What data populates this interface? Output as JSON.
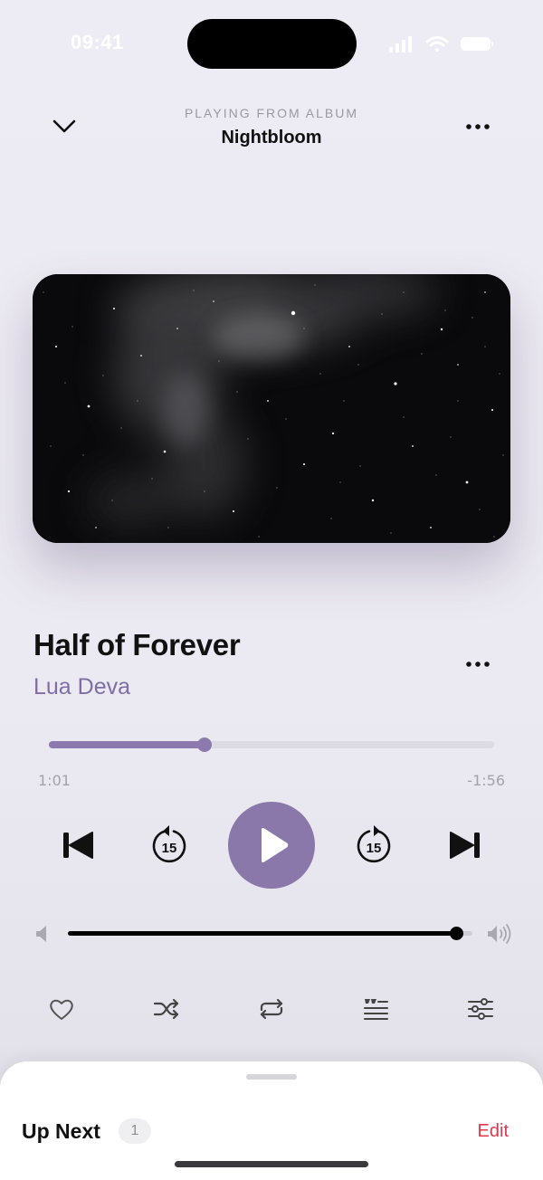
{
  "status_bar": {
    "time": "09:41"
  },
  "header": {
    "subtitle": "PLAYING FROM ALBUM",
    "title": "Nightbloom"
  },
  "track": {
    "title": "Half of Forever",
    "artist": "Lua Deva"
  },
  "progress": {
    "elapsed": "1:01",
    "remaining": "-1:56",
    "fraction": 0.35
  },
  "controls": {
    "skip_back_seconds": "15",
    "skip_forward_seconds": "15"
  },
  "volume": {
    "fraction": 0.96
  },
  "up_next": {
    "label": "Up Next",
    "count": "1",
    "edit_label": "Edit"
  },
  "colors": {
    "accent": "#8a78aa",
    "artist": "#7f6ea6",
    "edit": "#e0384a"
  },
  "icons": {
    "header": [
      "chevron-down-icon",
      "more-icon"
    ],
    "transport": [
      "previous-track-icon",
      "skip-back-15-icon",
      "play-icon",
      "skip-forward-15-icon",
      "next-track-icon"
    ],
    "actions": [
      "heart-icon",
      "shuffle-icon",
      "repeat-icon",
      "lyrics-icon",
      "equalizer-icon"
    ]
  }
}
